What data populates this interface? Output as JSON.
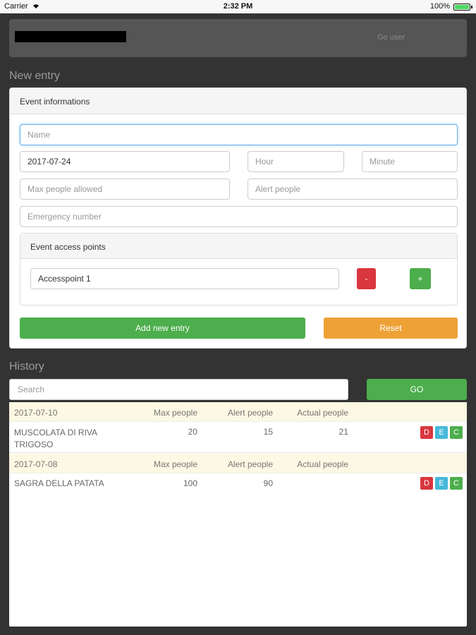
{
  "status_bar": {
    "carrier": "Carrier",
    "time": "2:32 PM",
    "battery": "100%"
  },
  "navbar": {
    "brand": "",
    "user_link": "Go user"
  },
  "new_entry": {
    "title": "New entry",
    "panel_heading": "Event informations",
    "name_placeholder": "Name",
    "date_value": "2017-07-24",
    "hour_placeholder": "Hour",
    "minute_placeholder": "Minute",
    "max_people_placeholder": "Max people allowed",
    "alert_people_placeholder": "Alert people",
    "emergency_placeholder": "Emergency number",
    "access_points": {
      "heading": "Event access points",
      "items": [
        {
          "value": "Accesspoint 1"
        }
      ],
      "remove_label": "-",
      "add_label": "+"
    },
    "add_button": "Add new entry",
    "reset_button": "Reset"
  },
  "history": {
    "title": "History",
    "search_placeholder": "Search",
    "go_button": "GO",
    "entries": [
      {
        "date": "2017-07-10",
        "col_max": "Max people",
        "col_alert": "Alert people",
        "col_actual": "Actual people",
        "name": "MUSCOLATA DI RIVA TRIGOSO",
        "max": "20",
        "alert": "15",
        "actual": "21",
        "actions": [
          "D",
          "E",
          "C"
        ]
      },
      {
        "date": "2017-07-08",
        "col_max": "Max people",
        "col_alert": "Alert people",
        "col_actual": "Actual people",
        "name": "SAGRA DELLA PATATA",
        "max": "100",
        "alert": "90",
        "actual": "",
        "actions": [
          "D",
          "E",
          "C"
        ]
      }
    ]
  },
  "colors": {
    "background": "#333333",
    "navbar": "#555555",
    "success": "#4cae4c",
    "danger": "#d9363e",
    "warning": "#eea236",
    "info": "#46b8da",
    "row_highlight": "#fcf8e3"
  }
}
